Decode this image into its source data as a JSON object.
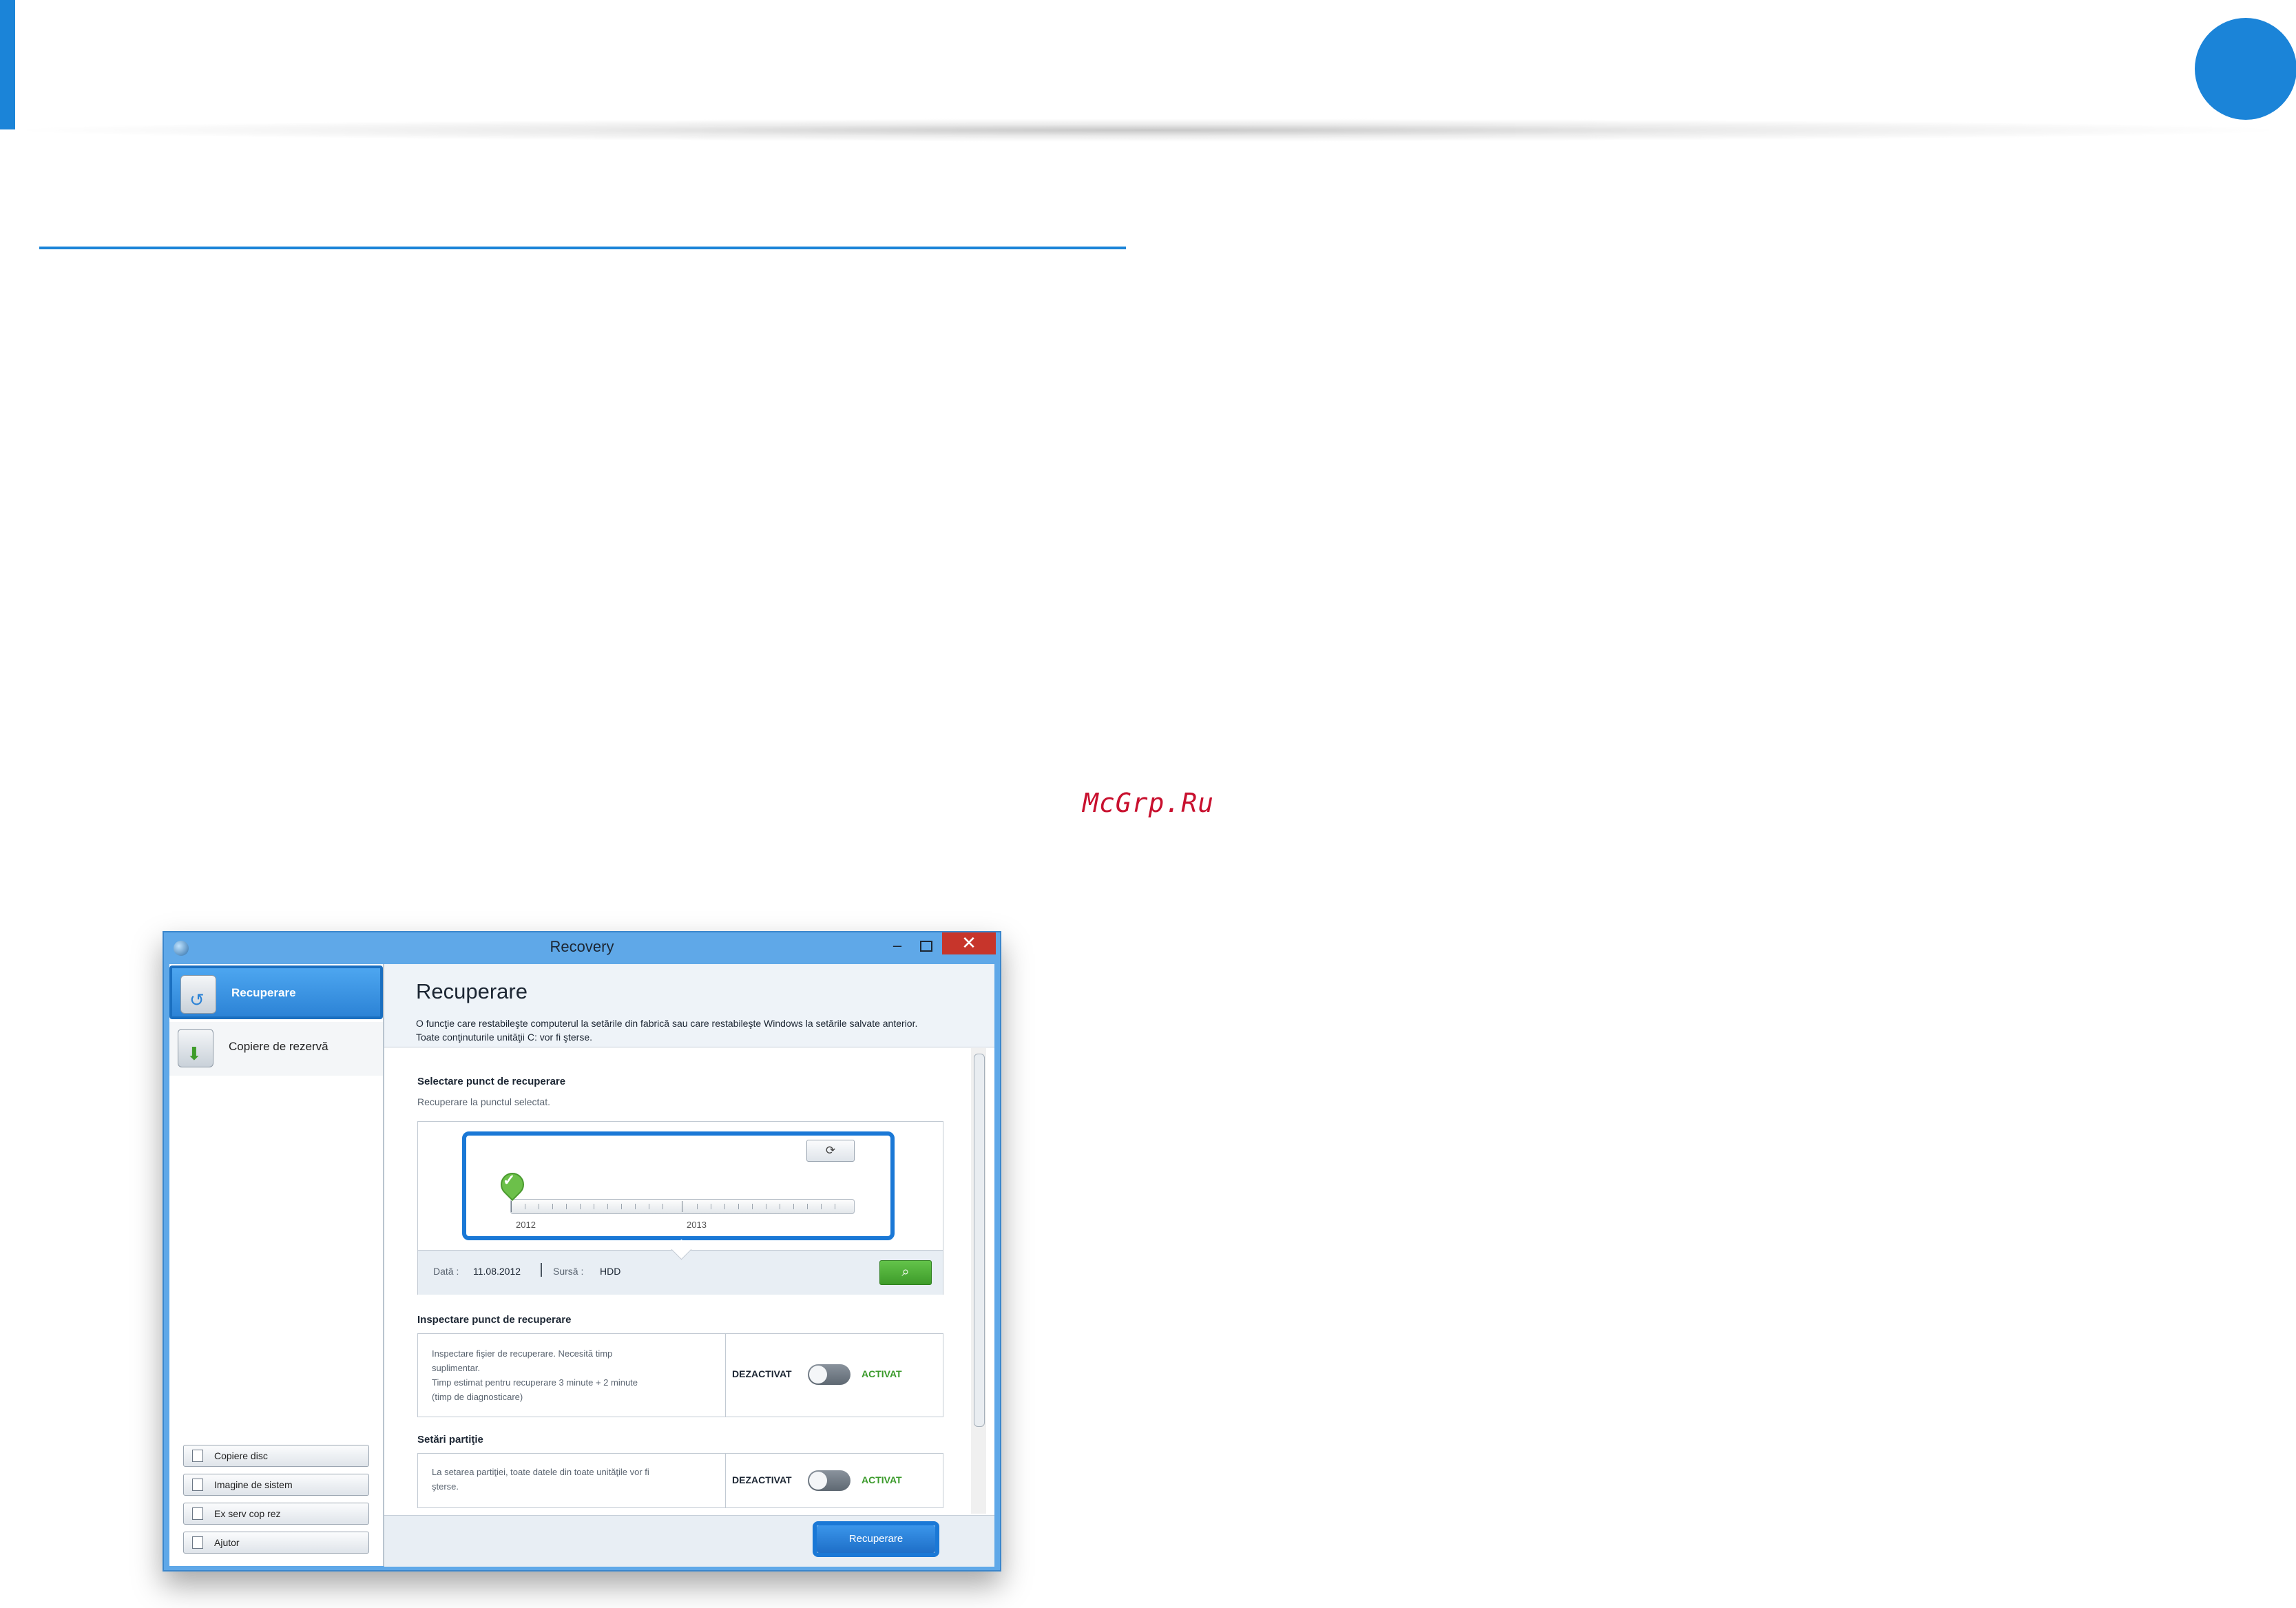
{
  "watermark": "McGrp.Ru",
  "window": {
    "title": "Recovery",
    "minimize_glyph": "–",
    "close_glyph": "✕"
  },
  "sidebar": {
    "items": [
      {
        "label": "Recuperare",
        "icon": "recovery-disk-icon",
        "active": true
      },
      {
        "label": "Copiere de rezervă",
        "icon": "backup-download-icon",
        "active": false
      }
    ],
    "buttons": [
      {
        "label": "Copiere disc",
        "icon": "copy-disc-icon"
      },
      {
        "label": "Imagine de sistem",
        "icon": "system-image-icon"
      },
      {
        "label": "Ex serv cop rez",
        "icon": "export-backup-icon"
      },
      {
        "label": "Ajutor",
        "icon": "help-icon"
      }
    ]
  },
  "main": {
    "title": "Recuperare",
    "description_line1": "O funcţie care restabileşte computerul la setările din fabrică sau care restabileşte Windows la setările salvate anterior.",
    "description_line2": "Toate conţinuturile unităţii C: vor fi şterse.",
    "restore_point": {
      "title": "Selectare punct de recuperare",
      "subtitle": "Recuperare la punctul selectat.",
      "years": [
        "2012",
        "2013"
      ],
      "date_label": "Dată :",
      "date_value": "11.08.2012",
      "source_label": "Sursă :",
      "source_value": "HDD"
    },
    "inspect": {
      "title": "Inspectare punct de recuperare",
      "line1": "Inspectare fişier de recuperare. Necesită timp",
      "line2": "suplimentar.",
      "line3": "Timp estimat pentru recuperare 3 minute + 2 minute",
      "line4": "(timp de diagnosticare)",
      "off_label": "DEZACTIVAT",
      "on_label": "ACTIVAT"
    },
    "partition": {
      "title": "Setări partiţie",
      "line1": "La setarea partiţiei, toate datele din toate unităţile vor fi",
      "line2": "şterse.",
      "off_label": "DEZACTIVAT",
      "on_label": "ACTIVAT"
    },
    "recover_button": "Recuperare"
  },
  "colors": {
    "accent": "#1b84d8",
    "watermark": "#c8102e",
    "active_green": "#3a9a2a"
  }
}
